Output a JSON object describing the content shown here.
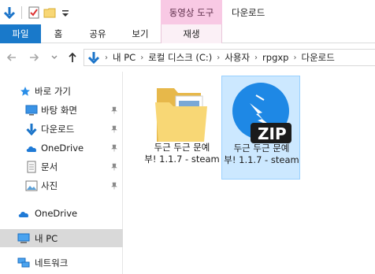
{
  "titlebar": {
    "context_tab": "동영상 도구",
    "window_title": "다운로드"
  },
  "ribbon": {
    "tabs": [
      "파일",
      "홈",
      "공유",
      "보기",
      "재생"
    ]
  },
  "address": {
    "crumbs": [
      "내 PC",
      "로컬 디스크 (C:)",
      "사용자",
      "rpgxp",
      "다운로드"
    ]
  },
  "sidebar": {
    "items": [
      {
        "label": "바로 가기",
        "icon": "star-icon",
        "pinned": false
      },
      {
        "label": "바탕 화면",
        "icon": "desktop-icon",
        "pinned": true
      },
      {
        "label": "다운로드",
        "icon": "download-arrow-icon",
        "pinned": true
      },
      {
        "label": "OneDrive",
        "icon": "cloud-icon",
        "pinned": true
      },
      {
        "label": "문서",
        "icon": "document-icon",
        "pinned": true
      },
      {
        "label": "사진",
        "icon": "picture-icon",
        "pinned": true
      },
      {
        "label": "OneDrive",
        "icon": "cloud-icon",
        "pinned": false
      },
      {
        "label": "내 PC",
        "icon": "computer-icon",
        "pinned": false
      },
      {
        "label": "네트워크",
        "icon": "network-icon",
        "pinned": false
      }
    ]
  },
  "files": [
    {
      "name_line1": "두근 두근 문예",
      "name_line2": "부! 1.1.7 - steam",
      "icon": "folder-icon"
    },
    {
      "name_line1": "두근 두근 문예",
      "name_line2": "부! 1.1.7 - steam",
      "icon": "zip-archive-icon",
      "badge": "ZIP"
    }
  ],
  "colors": {
    "accent": "#1979ca",
    "context_tab": "#f8c9e4",
    "selection": "#cce8ff",
    "folder": "#f8d775",
    "zip_blue": "#1e88e5"
  }
}
